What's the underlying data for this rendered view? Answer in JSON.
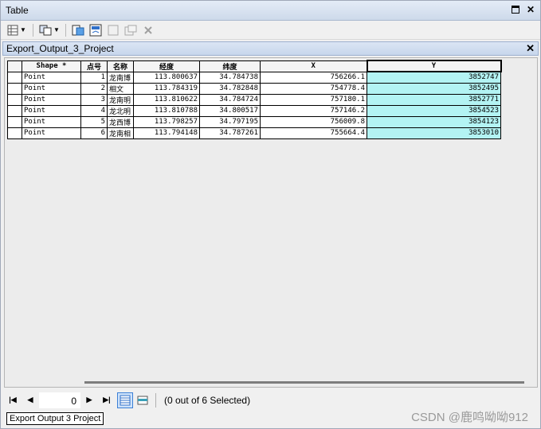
{
  "window": {
    "title": "Table"
  },
  "table_tab": {
    "title": "Export_Output_3_Project"
  },
  "grid": {
    "columns": [
      "Shape *",
      "点号",
      "名称",
      "经度",
      "纬度",
      "X",
      "Y"
    ],
    "rows": [
      [
        "Point",
        "1",
        "龙南博",
        "113.800637",
        "34.784738",
        "756266.1",
        "3852747"
      ],
      [
        "Point",
        "2",
        "相文",
        "113.784319",
        "34.782848",
        "754778.4",
        "3852495"
      ],
      [
        "Point",
        "3",
        "龙南明",
        "113.810622",
        "34.784724",
        "757180.1",
        "3852771"
      ],
      [
        "Point",
        "4",
        "龙北明",
        "113.810788",
        "34.800517",
        "757146.2",
        "3854523"
      ],
      [
        "Point",
        "5",
        "龙西博",
        "113.798257",
        "34.797195",
        "756009.8",
        "3854123"
      ],
      [
        "Point",
        "6",
        "龙南相",
        "113.794148",
        "34.787261",
        "755664.4",
        "3853010"
      ]
    ]
  },
  "navigation": {
    "record": "0",
    "selection_status": "(0 out of 6 Selected)"
  },
  "bottom_tab": {
    "label": "Export Output 3 Project"
  },
  "watermark": "CSDN @鹿鸣呦呦912",
  "colors": {
    "selected_column": "#b3f3f3",
    "title_bar": "#cdd9ea"
  }
}
